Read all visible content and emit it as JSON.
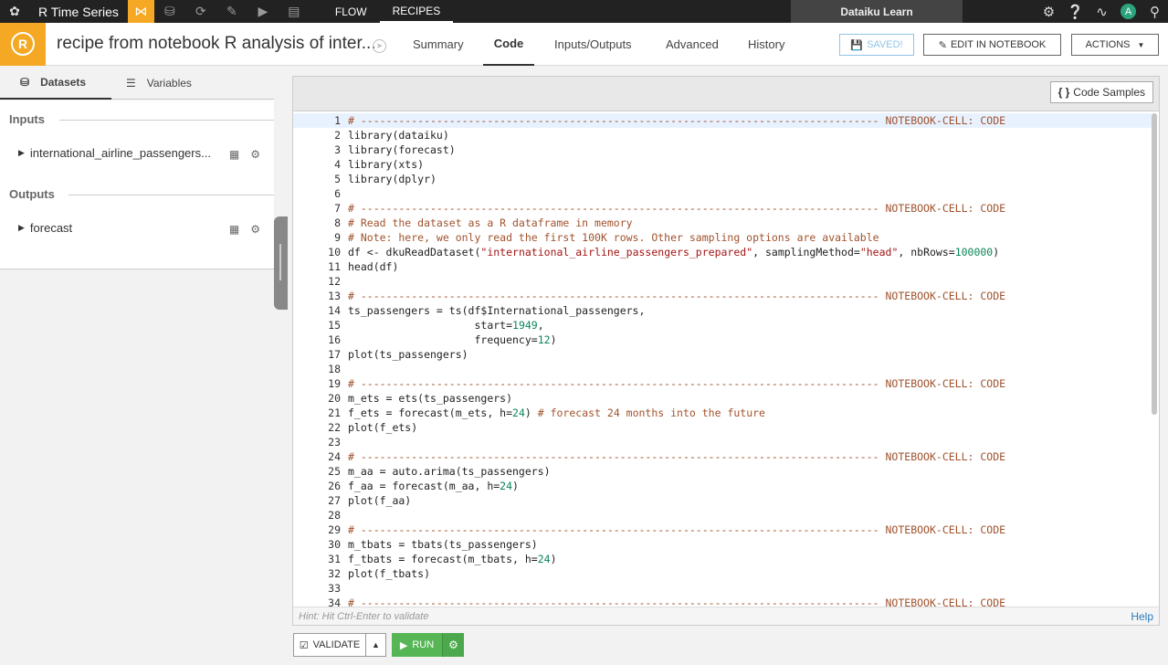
{
  "topnav": {
    "project": "R Time Series",
    "links": [
      "FLOW",
      "RECIPES"
    ],
    "learn": "Dataiku Learn",
    "avatar": "A",
    "icons": [
      "bird-logo-icon",
      "flow-icon",
      "datasets-icon",
      "sync-icon",
      "notebook-icon",
      "play-icon",
      "dashboard-icon",
      "gear-icon",
      "help-icon",
      "activity-icon",
      "search-icon"
    ]
  },
  "header": {
    "title": "recipe from notebook R analysis of inter...",
    "tabs": [
      "Summary",
      "Code",
      "Inputs/Outputs",
      "Advanced",
      "History"
    ],
    "saved": "SAVED!",
    "edit_notebook": "EDIT IN NOTEBOOK",
    "actions": "ACTIONS"
  },
  "left": {
    "tabs": [
      "Datasets",
      "Variables"
    ],
    "inputs_label": "Inputs",
    "outputs_label": "Outputs",
    "input_item": "international_airline_passengers...",
    "output_item": "forecast"
  },
  "editor": {
    "code_samples": "Code Samples",
    "hint": "Hint: Hit Ctrl-Enter to validate",
    "help": "Help",
    "lines": [
      {
        "n": "1",
        "t": "# ---------------------------------------------------------------------------------- NOTEBOOK-CELL: CODE",
        "k": "cmt"
      },
      {
        "n": "2",
        "t": "library(dataiku)",
        "k": ""
      },
      {
        "n": "3",
        "t": "library(forecast)",
        "k": ""
      },
      {
        "n": "4",
        "t": "library(xts)",
        "k": ""
      },
      {
        "n": "5",
        "t": "library(dplyr)",
        "k": ""
      },
      {
        "n": "6",
        "t": "",
        "k": ""
      },
      {
        "n": "7",
        "t": "# ---------------------------------------------------------------------------------- NOTEBOOK-CELL: CODE",
        "k": "cmt"
      },
      {
        "n": "8",
        "t": "# Read the dataset as a R dataframe in memory",
        "k": "cmt"
      },
      {
        "n": "9",
        "t": "# Note: here, we only read the first 100K rows. Other sampling options are available",
        "k": "cmt"
      },
      {
        "n": "10",
        "t": "df <- dkuReadDataset(\"international_airline_passengers_prepared\", samplingMethod=\"head\", nbRows=100000)",
        "k": ""
      },
      {
        "n": "11",
        "t": "head(df)",
        "k": ""
      },
      {
        "n": "12",
        "t": "",
        "k": ""
      },
      {
        "n": "13",
        "t": "# ---------------------------------------------------------------------------------- NOTEBOOK-CELL: CODE",
        "k": "cmt"
      },
      {
        "n": "14",
        "t": "ts_passengers = ts(df$International_passengers,",
        "k": ""
      },
      {
        "n": "15",
        "t": "                    start=1949,",
        "k": ""
      },
      {
        "n": "16",
        "t": "                    frequency=12)",
        "k": ""
      },
      {
        "n": "17",
        "t": "plot(ts_passengers)",
        "k": ""
      },
      {
        "n": "18",
        "t": "",
        "k": ""
      },
      {
        "n": "19",
        "t": "# ---------------------------------------------------------------------------------- NOTEBOOK-CELL: CODE",
        "k": "cmt"
      },
      {
        "n": "20",
        "t": "m_ets = ets(ts_passengers)",
        "k": ""
      },
      {
        "n": "21",
        "t": "f_ets = forecast(m_ets, h=24) # forecast 24 months into the future",
        "k": ""
      },
      {
        "n": "22",
        "t": "plot(f_ets)",
        "k": ""
      },
      {
        "n": "23",
        "t": "",
        "k": ""
      },
      {
        "n": "24",
        "t": "# ---------------------------------------------------------------------------------- NOTEBOOK-CELL: CODE",
        "k": "cmt"
      },
      {
        "n": "25",
        "t": "m_aa = auto.arima(ts_passengers)",
        "k": ""
      },
      {
        "n": "26",
        "t": "f_aa = forecast(m_aa, h=24)",
        "k": ""
      },
      {
        "n": "27",
        "t": "plot(f_aa)",
        "k": ""
      },
      {
        "n": "28",
        "t": "",
        "k": ""
      },
      {
        "n": "29",
        "t": "# ---------------------------------------------------------------------------------- NOTEBOOK-CELL: CODE",
        "k": "cmt"
      },
      {
        "n": "30",
        "t": "m_tbats = tbats(ts_passengers)",
        "k": ""
      },
      {
        "n": "31",
        "t": "f_tbats = forecast(m_tbats, h=24)",
        "k": ""
      },
      {
        "n": "32",
        "t": "plot(f_tbats)",
        "k": ""
      },
      {
        "n": "33",
        "t": "",
        "k": ""
      },
      {
        "n": "34",
        "t": "# ---------------------------------------------------------------------------------- NOTEBOOK-CELL: CODE",
        "k": "cmt"
      }
    ]
  },
  "bottom": {
    "validate": "VALIDATE",
    "run": "RUN"
  }
}
